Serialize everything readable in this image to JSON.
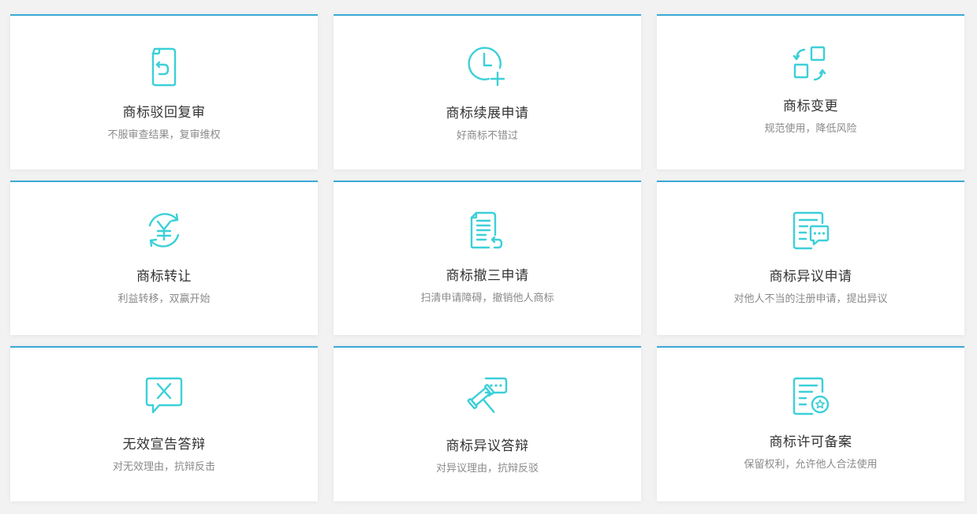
{
  "services": [
    {
      "title": "商标驳回复审",
      "desc": "不服审查结果，复审维权",
      "icon": "document-return-icon"
    },
    {
      "title": "商标续展申请",
      "desc": "好商标不错过",
      "icon": "clock-plus-icon"
    },
    {
      "title": "商标变更",
      "desc": "规范使用，降低风险",
      "icon": "swap-squares-icon"
    },
    {
      "title": "商标转让",
      "desc": "利益转移，双赢开始",
      "icon": "yen-exchange-icon"
    },
    {
      "title": "商标撤三申请",
      "desc": "扫清申请障碍，撤销他人商标",
      "icon": "document-undo-icon"
    },
    {
      "title": "商标异议申请",
      "desc": "对他人不当的注册申请，提出异议",
      "icon": "document-chat-icon"
    },
    {
      "title": "无效宣告答辩",
      "desc": "对无效理由，抗辩反击",
      "icon": "chat-x-icon"
    },
    {
      "title": "商标异议答辩",
      "desc": "对异议理由，抗辩反驳",
      "icon": "gavel-chat-icon"
    },
    {
      "title": "商标许可备案",
      "desc": "保留权利，允许他人合法使用",
      "icon": "document-star-icon"
    }
  ],
  "colors": {
    "accent_border": "#3aa8d6",
    "icon": "#3cd0d8"
  }
}
